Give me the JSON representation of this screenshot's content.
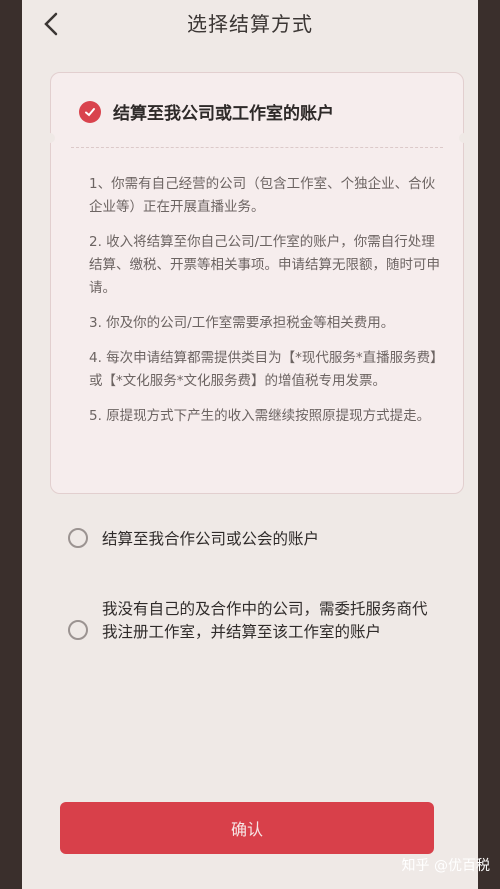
{
  "header": {
    "title": "选择结算方式",
    "back_icon": "back-arrow-icon"
  },
  "options": [
    {
      "label": "结算至我公司或工作室的账户",
      "selected": true
    },
    {
      "label": "结算至我合作公司或公会的账户",
      "selected": false
    },
    {
      "label": "我没有自己的及合作中的公司，需委托服务商代我注册工作室，并结算至该工作室的账户",
      "selected": false
    }
  ],
  "terms": [
    "1、你需有自己经营的公司（包含工作室、个独企业、合伙企业等）正在开展直播业务。",
    "2. 收入将结算至你自己公司/工作室的账户，你需自行处理结算、缴税、开票等相关事项。申请结算无限额，随时可申请。",
    "3. 你及你的公司/工作室需要承担税金等相关费用。",
    "4. 每次申请结算都需提供类目为【*现代服务*直播服务费】或【*文化服务*文化服务费】的增值税专用发票。",
    "5. 原提现方式下产生的收入需继续按照原提现方式提走。"
  ],
  "confirm_label": "确认",
  "watermark": "知乎 @优百税",
  "colors": {
    "accent": "#d8404a",
    "card_bg": "#f6eded",
    "page_bg": "#efe9e6"
  }
}
